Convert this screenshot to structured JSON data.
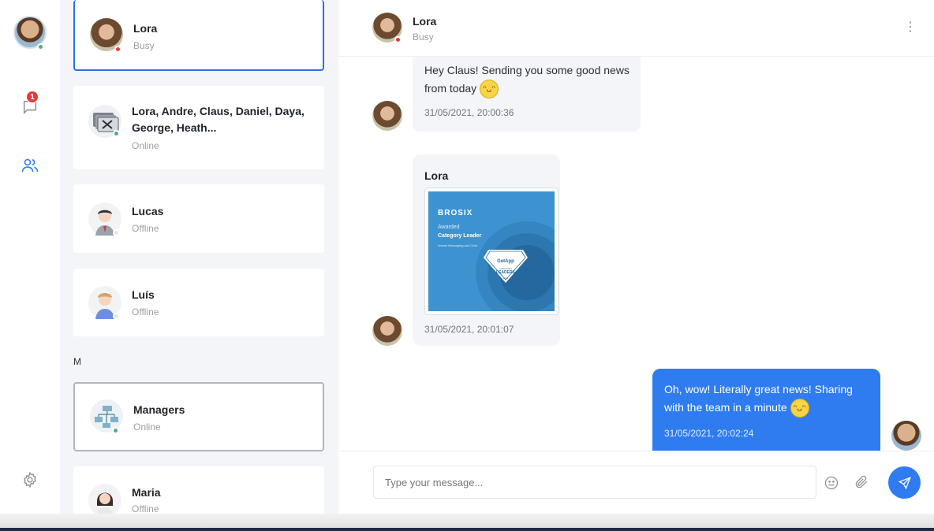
{
  "me": {
    "status": "online"
  },
  "rail": {
    "unread_badge": "1"
  },
  "contacts": [
    {
      "name": "Lora",
      "status": "Busy"
    },
    {
      "name": "Lora, Andre, Claus, Daniel, Daya, George, Heath...",
      "status": "Online"
    },
    {
      "name": "Lucas",
      "status": "Offline"
    },
    {
      "name": "Luís",
      "status": "Offline"
    },
    {
      "name": "Managers",
      "status": "Online"
    },
    {
      "name": "Maria",
      "status": "Offline"
    }
  ],
  "section_letter": "M",
  "chat": {
    "header": {
      "name": "Lora",
      "status": "Busy"
    },
    "messages": [
      {
        "text": "Hey Claus! Sending you some good news from today",
        "time": "31/05/2021, 20:00:36"
      },
      {
        "sender": "Lora",
        "time": "31/05/2021, 20:01:07",
        "image": {
          "brand": "BROSIX",
          "line1": "Awarded",
          "line2": "Category Leader",
          "line3": "Instant Messaging and Chat",
          "badge_brand": "GetApp",
          "badge_small": "CATEGORY",
          "badge_big": "LEADERS",
          "badge_year": "2021"
        }
      },
      {
        "text": "Oh, wow! Literally great news! Sharing with the team in a minute",
        "time": "31/05/2021, 20:02:24"
      }
    ]
  },
  "composer": {
    "placeholder": "Type your message..."
  },
  "colors": {
    "accent": "#2f7cf0",
    "busy": "#e53935",
    "online": "#4caf7f",
    "panel_bg": "#f4f5f9"
  }
}
